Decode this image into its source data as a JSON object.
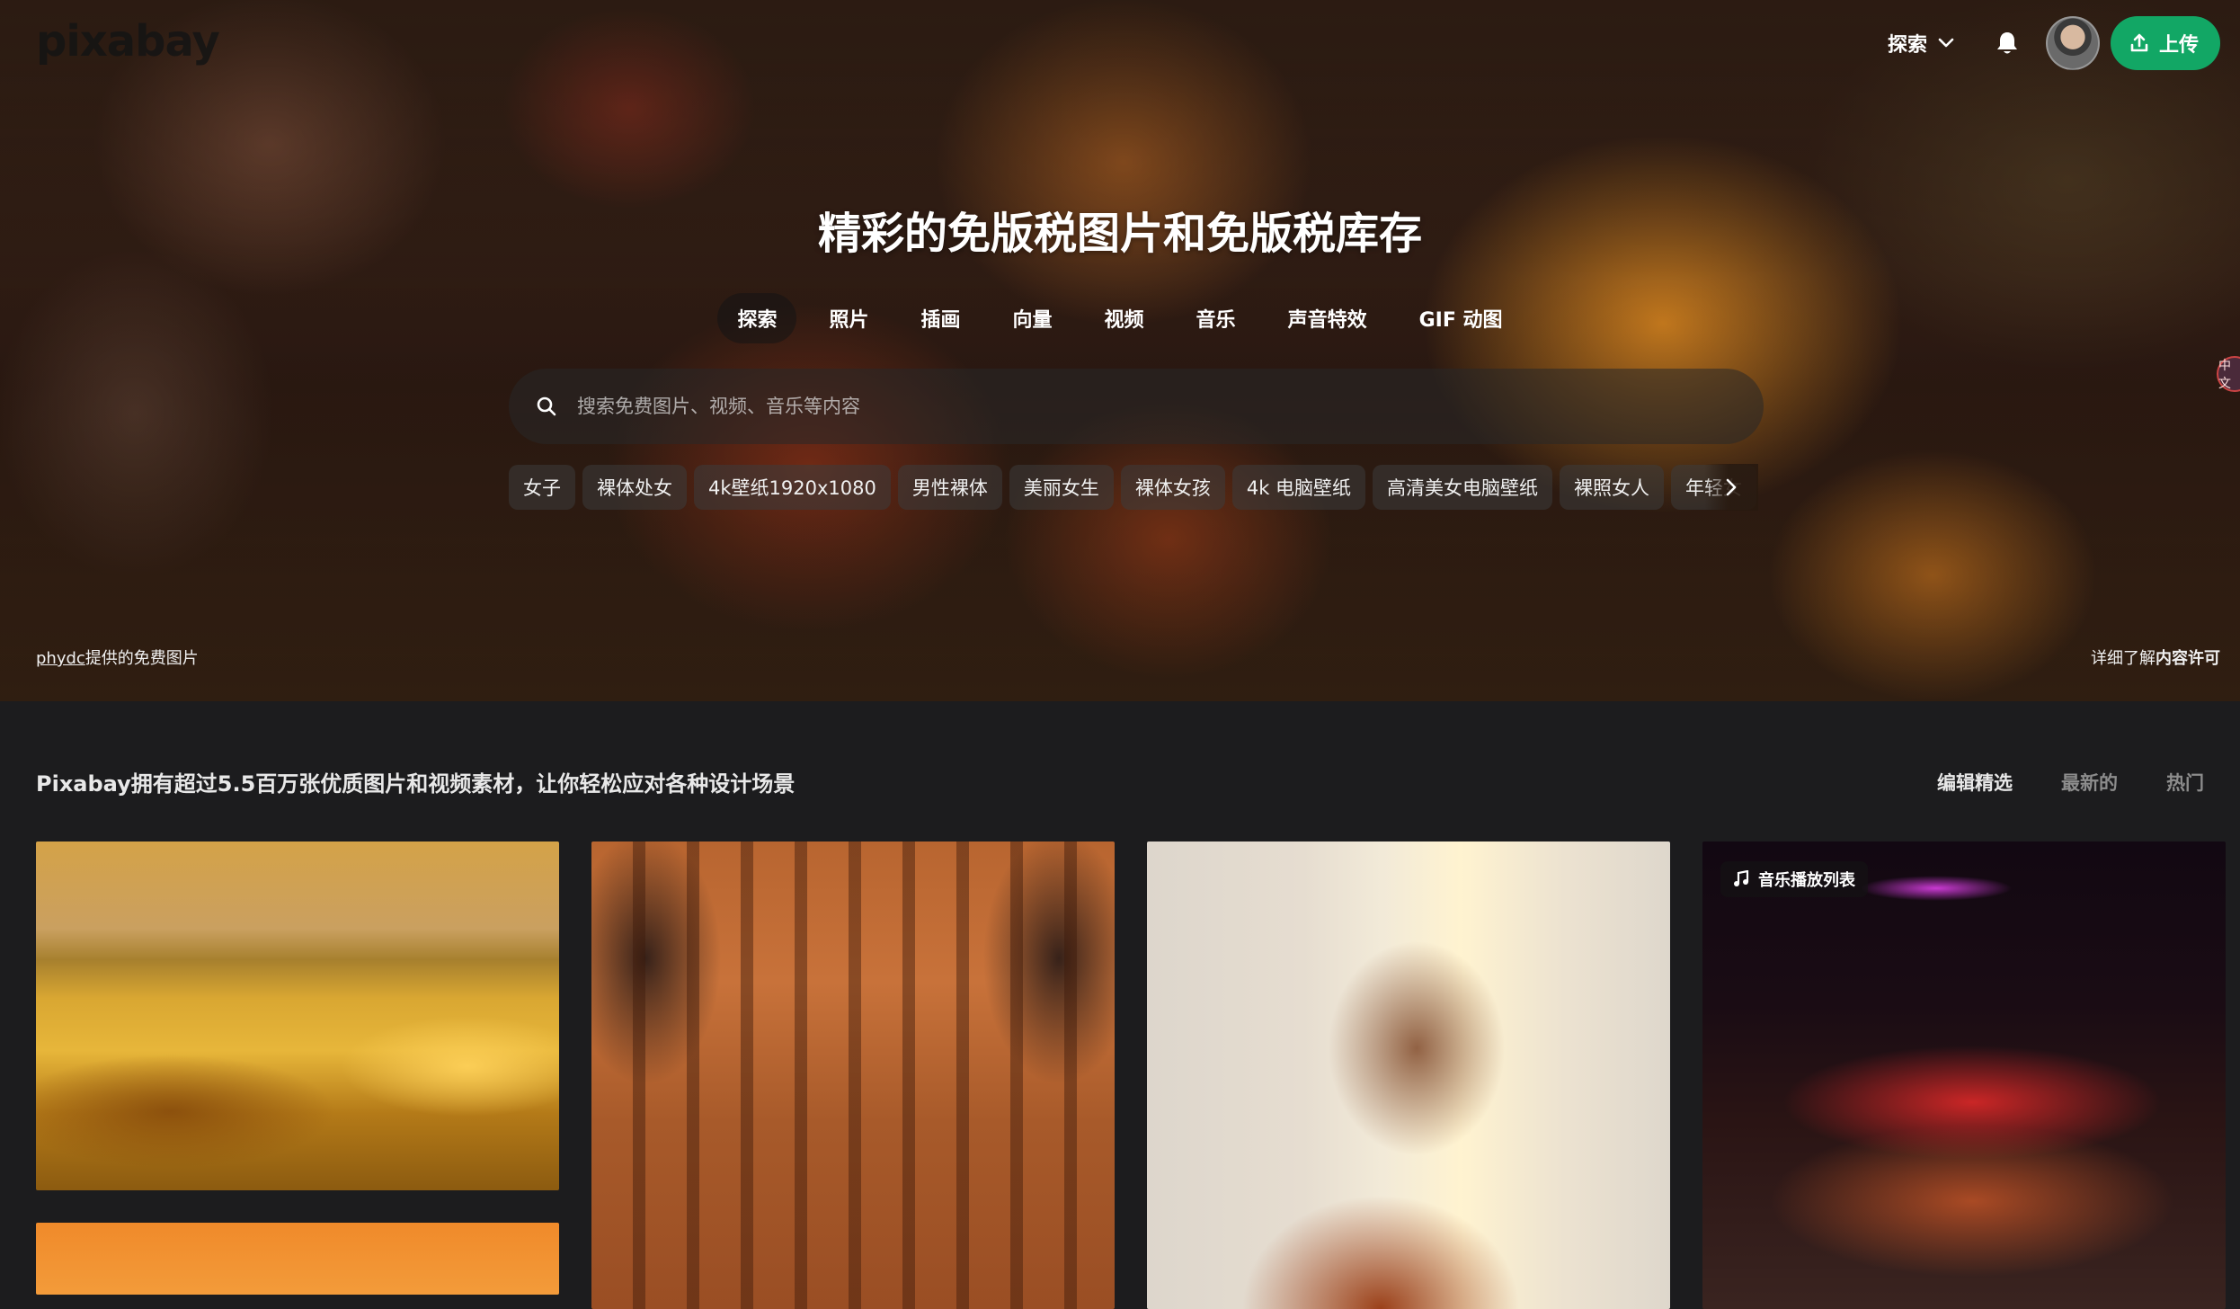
{
  "header": {
    "logo": "pixabay",
    "explore_label": "探索",
    "upload_label": "上传"
  },
  "hero": {
    "title": "精彩的免版税图片和免版税库存",
    "tabs": [
      {
        "label": "探索",
        "active": true
      },
      {
        "label": "照片",
        "active": false
      },
      {
        "label": "插画",
        "active": false
      },
      {
        "label": "向量",
        "active": false
      },
      {
        "label": "视频",
        "active": false
      },
      {
        "label": "音乐",
        "active": false
      },
      {
        "label": "声音特效",
        "active": false
      },
      {
        "label": "GIF 动图",
        "active": false
      }
    ],
    "search_placeholder": "搜索免费图片、视频、音乐等内容",
    "chips": [
      "女子",
      "裸体处女",
      "4k壁纸1920x1080",
      "男性裸体",
      "美丽女生",
      "裸体女孩",
      "4k 电脑壁纸",
      "高清美女电脑壁纸",
      "裸照女人",
      "年轻女"
    ],
    "side_tab": "中文",
    "credit_author": "phydc",
    "credit_suffix": "提供的免费图片",
    "license_prefix": "详细了解",
    "license_link": "内容许可"
  },
  "main": {
    "section_title": "Pixabay拥有超过5.5百万张优质图片和视频素材，让你轻松应对各种设计场景",
    "sort_tabs": [
      {
        "label": "编辑精选",
        "active": true
      },
      {
        "label": "最新的",
        "active": false
      },
      {
        "label": "热门",
        "active": false
      }
    ],
    "music_badge": "音乐播放列表"
  },
  "colors": {
    "accent_green": "#12a765",
    "page_bg": "#1c1c1e"
  }
}
